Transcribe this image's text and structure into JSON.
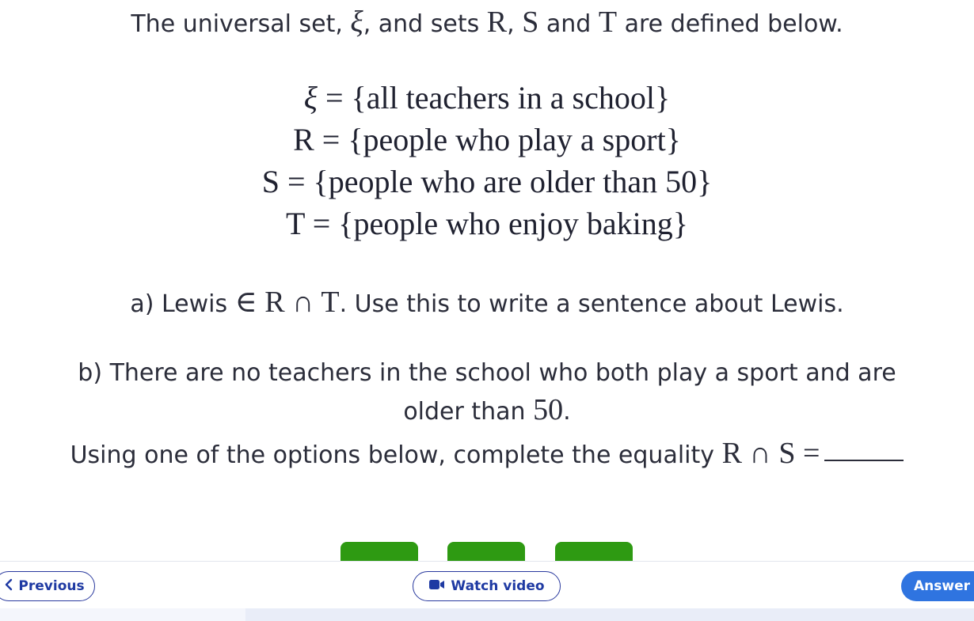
{
  "intro": {
    "before": "The universal set, ",
    "xi": "ξ",
    "mid1": ", and sets ",
    "R": "R",
    "sep1": ", ",
    "S": "S",
    "and": " and ",
    "T": "T",
    "after": " are defined below."
  },
  "sets": [
    {
      "symbol": "ξ",
      "definition": " = {all teachers in a school}"
    },
    {
      "symbol": "R",
      "definition": " = {people who play a sport}"
    },
    {
      "symbol": "S",
      "definition": " = {people who are older than 50}"
    },
    {
      "symbol": "T",
      "definition": " = {people who enjoy baking}"
    }
  ],
  "question_a": {
    "prefix": "a) Lewis ",
    "math": "∈ R ∩ T",
    "suffix": ". Use this to write a sentence about Lewis."
  },
  "question_b": {
    "line1": "b) There are no teachers in the school who both play a sport and are",
    "line2_text": "older than ",
    "line2_math": "50",
    "line2_end": ".",
    "line3_text": "Using one of the options below, complete the equality ",
    "line3_math": "R ∩ S ="
  },
  "answer_options_count": 3,
  "colors": {
    "option_green": "#2e9a12",
    "nav_blue": "#1f3aa3",
    "answer_blue": "#2f74e0",
    "text": "#2b2d3a"
  },
  "nav": {
    "previous_icon": "chevron-left-icon",
    "previous_label": "Previous",
    "video_icon": "video-camera-icon",
    "video_label": "Watch video",
    "answer_label": "Answer"
  }
}
